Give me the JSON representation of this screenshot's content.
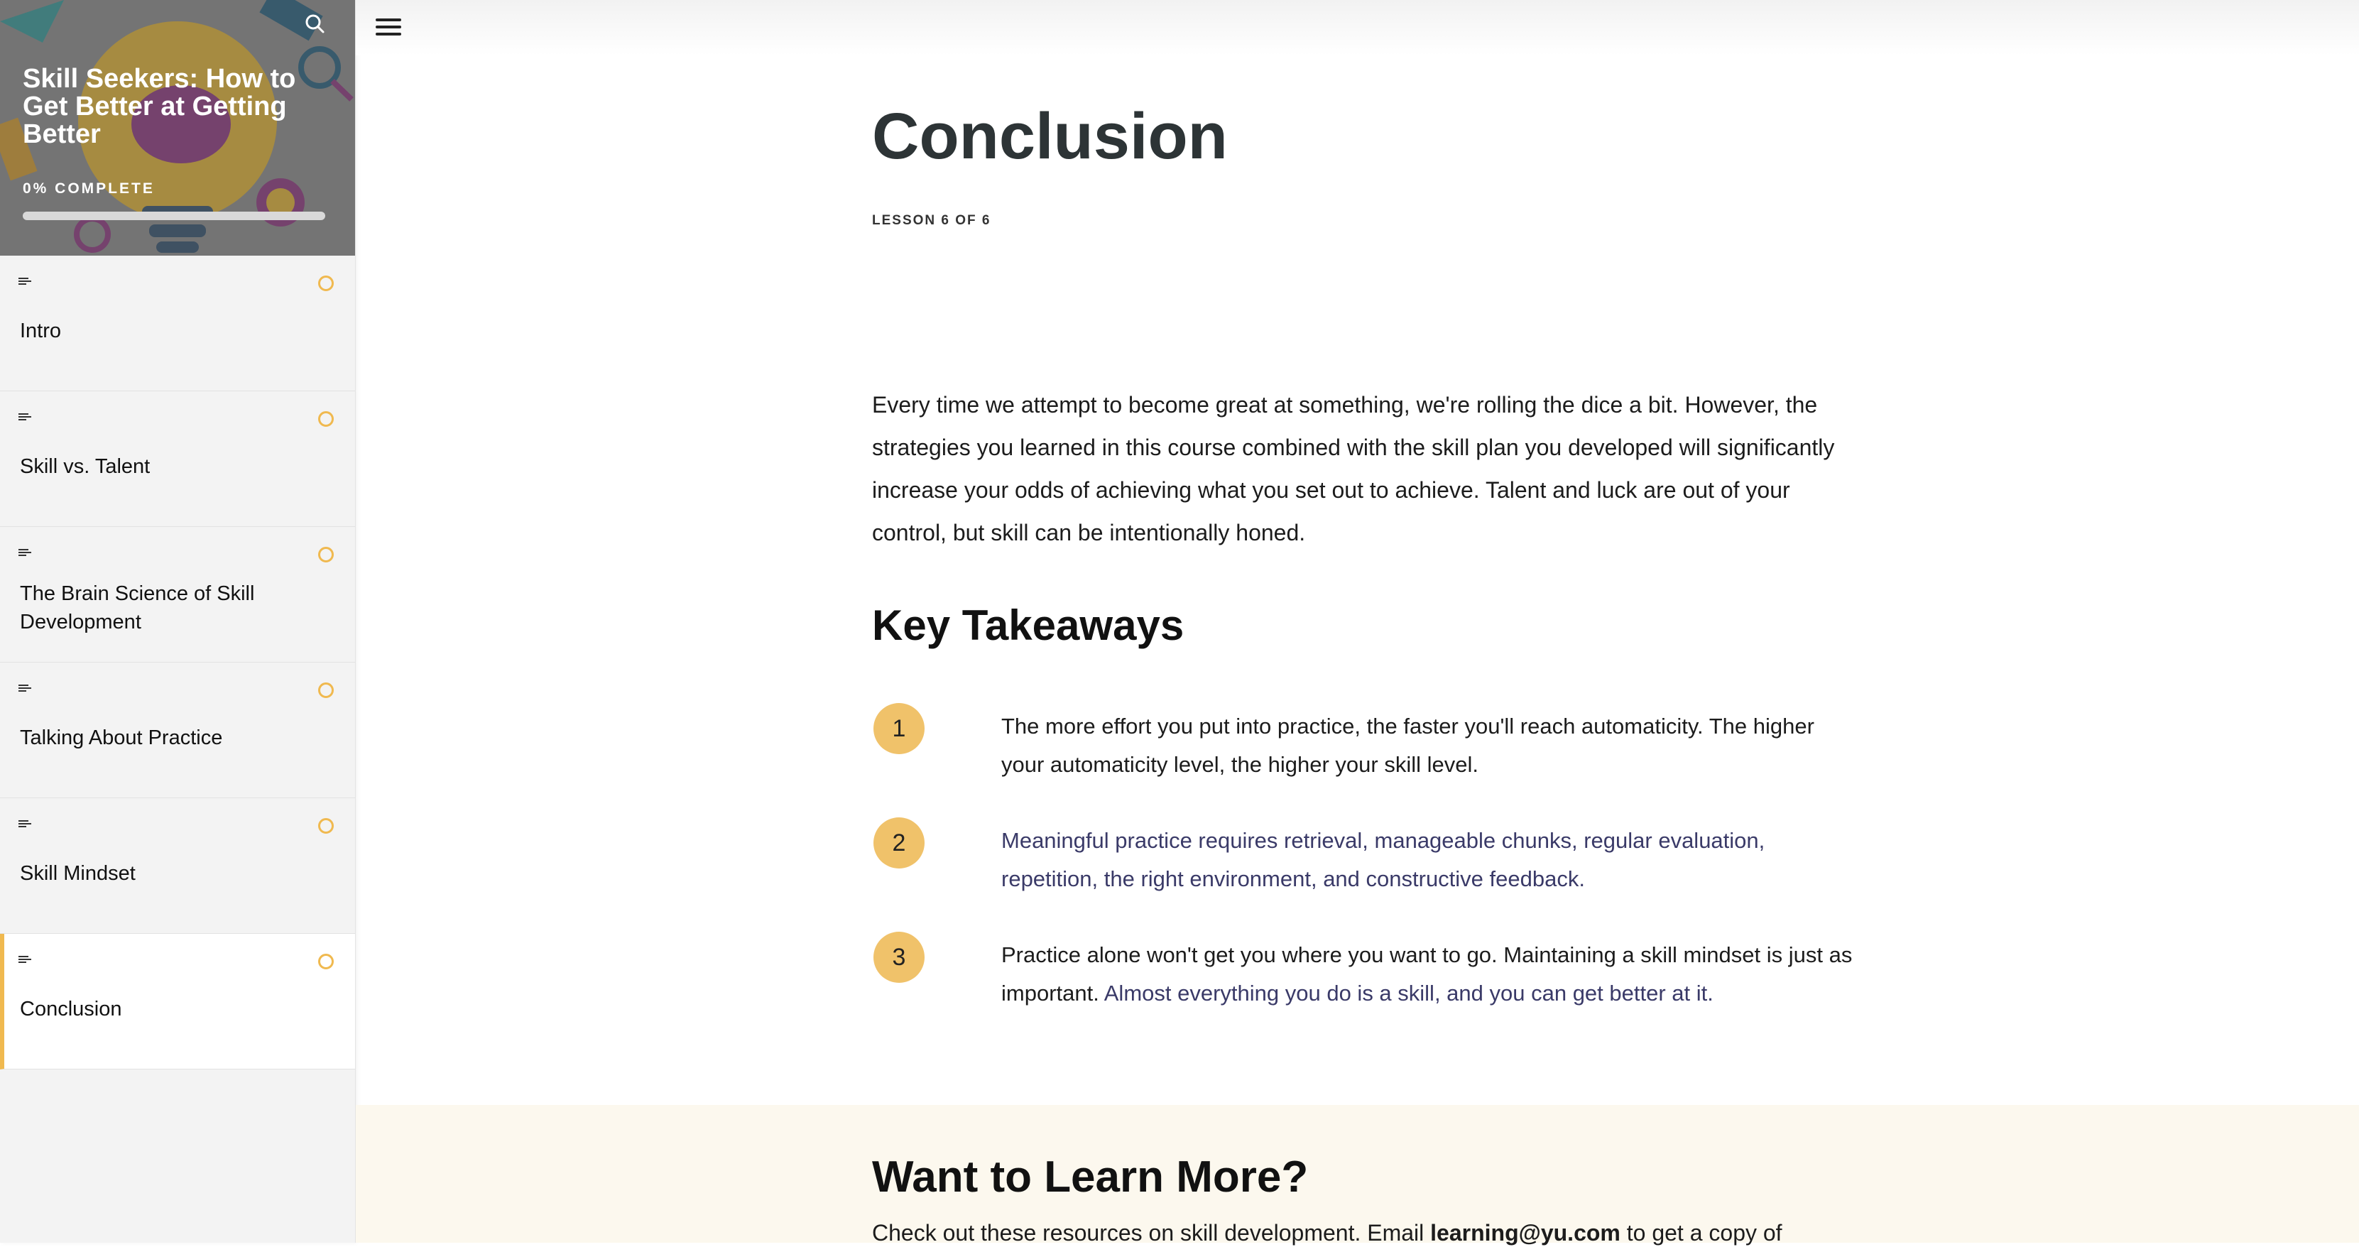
{
  "sidebar": {
    "course_title": "Skill Seekers: How to Get Better at Getting Better",
    "progress_label": "0% COMPLETE",
    "progress_fraction": 0,
    "lessons": [
      {
        "label": "Intro"
      },
      {
        "label": "Skill vs. Talent"
      },
      {
        "label": "The Brain Science of Skill Development"
      },
      {
        "label": "Talking About Practice"
      },
      {
        "label": "Skill Mindset"
      },
      {
        "label": "Conclusion"
      }
    ]
  },
  "lesson": {
    "title": "Conclusion",
    "count": "LESSON 6 OF 6",
    "intro": "Every time we attempt to become great at something, we're rolling the dice a bit. However, the strategies you learned in this course combined with the skill plan you developed will significantly increase your odds of achieving what you set out to achieve. Talent and luck are out of your control, but skill can be intentionally honed.",
    "takeaways_title": "Key Takeaways",
    "takeaways": [
      {
        "number": "1",
        "text": "The more effort you put into practice, the faster you'll reach automaticity. The higher your automaticity level, the higher your skill level."
      },
      {
        "number": "2",
        "text": "Meaningful practice requires retrieval, manageable chunks, regular evaluation, repetition, the right environment, and constructive feedback."
      },
      {
        "number": "3",
        "text_a": "Practice alone won't get you where you want to go. Maintaining a skill mindset is just as important. ",
        "text_b": "Almost everything you do is a skill, and you can get better at it."
      }
    ]
  },
  "learn_more": {
    "title": "Want to Learn More?",
    "text_before": "Check out these resources on skill development. Email ",
    "email": "learning@yu.com",
    "text_after": " to get a copy of"
  },
  "colors": {
    "accent": "#f0b94f",
    "badge": "#f0c26a",
    "bottom_bg": "#fcf8ee"
  },
  "icons": {
    "search": "search-icon",
    "menu": "hamburger-menu-icon",
    "lesson_type": "text-lines-icon",
    "status": "incomplete-circle-icon"
  }
}
